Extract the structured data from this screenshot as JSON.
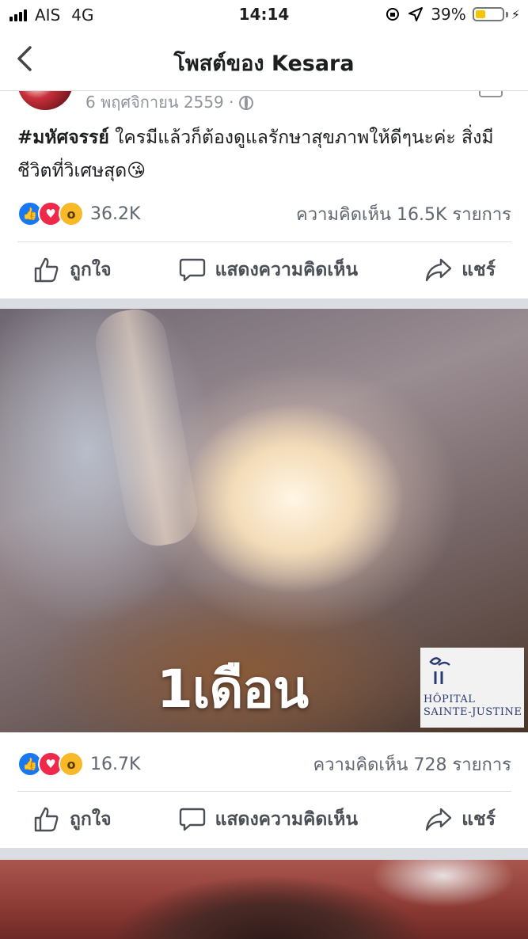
{
  "status_bar": {
    "carrier": "AIS",
    "network": "4G",
    "time": "14:14",
    "battery_text": "39%",
    "battery_level": 0.39
  },
  "nav": {
    "title": "โพสต์ของ Kesara"
  },
  "post": {
    "date": "6 พฤศจิกายน 2559 ·",
    "hashtag": "#มหัศจรรย์",
    "text": " ใครมีแล้วก็ต้องดูแลรักษาสุขภาพให้ดีๆนะค่ะ สิ่งมีชีวิตที่วิเศษสุด😘",
    "reactions_count": "36.2K",
    "comments_count": "ความคิดเห็น 16.5K รายการ"
  },
  "photo": {
    "caption": "1เดือน",
    "logo_line1": "HÔPITAL",
    "logo_line2": "SAINTE-JUSTINE",
    "reactions_count": "16.7K",
    "comments_count": "ความคิดเห็น 728 รายการ"
  },
  "actions": {
    "like": "ถูกใจ",
    "comment": "แสดงความคิดเห็น",
    "share": "แชร์"
  },
  "icons": {
    "like": "thumbs-up-icon",
    "love": "heart-icon",
    "wow": "wow-face-icon",
    "comment": "speech-bubble-icon",
    "share": "share-arrow-icon",
    "back": "chevron-left-icon"
  },
  "colors": {
    "like_blue": "#1877f2",
    "love_red": "#f0284a",
    "wow_yellow": "#f7b928",
    "battery_yellow": "#f5c500"
  }
}
